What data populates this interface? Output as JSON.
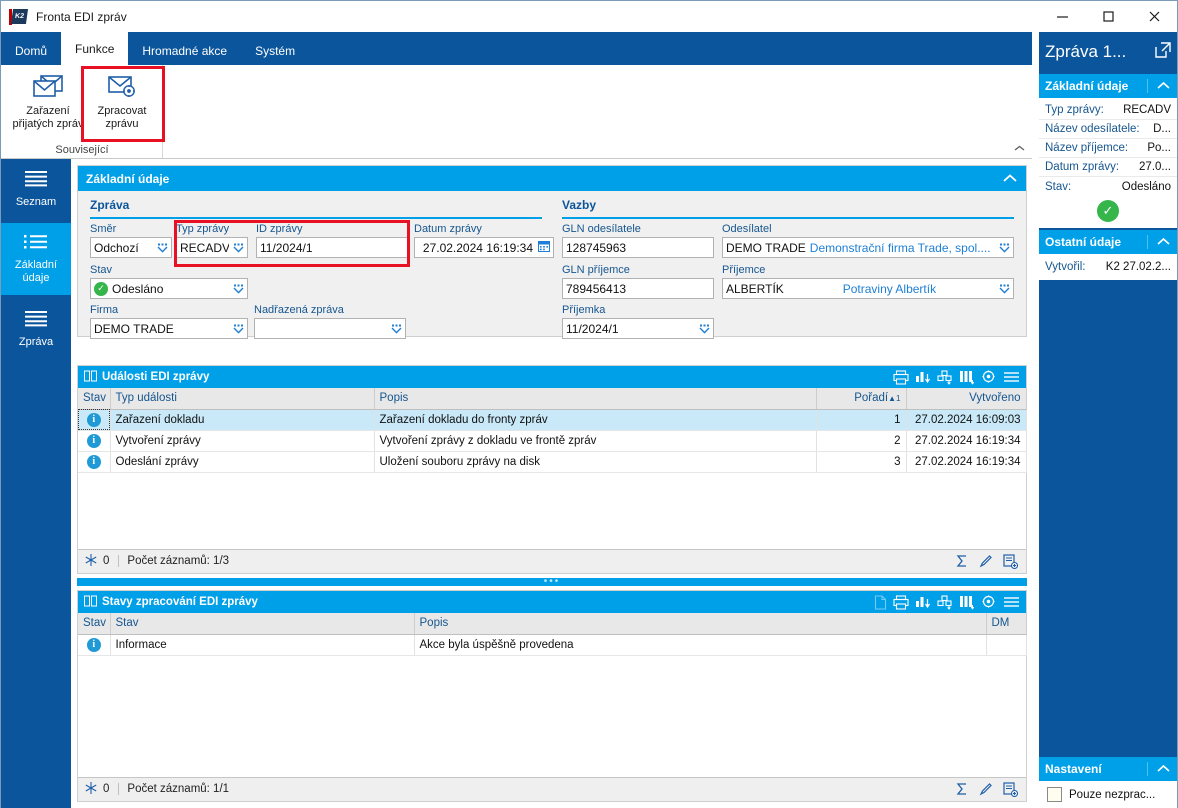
{
  "window": {
    "title": "Fronta EDI zpráv",
    "app_badge": "K2",
    "minimize": "—",
    "maximize": "□",
    "close": "✕"
  },
  "ribbon": {
    "tabs": [
      {
        "label": "Domů",
        "active": false
      },
      {
        "label": "Funkce",
        "active": true
      },
      {
        "label": "Hromadné akce",
        "active": false
      },
      {
        "label": "Systém",
        "active": false
      }
    ],
    "group_label": "Související",
    "buttons": [
      {
        "line1": "Zařazení",
        "line2": "přijatých zpráv",
        "icon": "envelope-icon",
        "highlighted": false
      },
      {
        "line1": "Zpracovat",
        "line2": "zprávu",
        "icon": "envelope-gear-icon",
        "highlighted": true
      }
    ]
  },
  "leftnav": {
    "items": [
      {
        "label": "Seznam",
        "icon": "list-icon",
        "active": false
      },
      {
        "label": "Základní údaje",
        "icon": "bullet-list-icon",
        "active": true
      },
      {
        "label": "Zpráva",
        "icon": "list-icon",
        "active": false
      }
    ]
  },
  "basic_panel": {
    "title": "Základní údaje",
    "message_section": {
      "title": "Zpráva",
      "smer": {
        "label": "Směr",
        "value": "Odchozí"
      },
      "typ_zpravy": {
        "label": "Typ zprávy",
        "value": "RECADV"
      },
      "id_zpravy": {
        "label": "ID zprávy",
        "value": "11/2024/1"
      },
      "datum_zpravy": {
        "label": "Datum zprávy",
        "value": "27.02.2024 16:19:34"
      },
      "stav": {
        "label": "Stav",
        "value": "Odesláno"
      },
      "firma": {
        "label": "Firma",
        "value": "DEMO TRADE"
      },
      "nadrazena_zprava": {
        "label": "Nadřazená zpráva",
        "value": ""
      }
    },
    "links_section": {
      "title": "Vazby",
      "gln_odesilatele": {
        "label": "GLN odesílatele",
        "value": "128745963"
      },
      "odesilatel": {
        "label": "Odesílatel",
        "value": "DEMO TRADE",
        "sub": "Demonstrační firma Trade, spol...."
      },
      "gln_prijemce": {
        "label": "GLN příjemce",
        "value": "789456413"
      },
      "prijemce": {
        "label": "Příjemce",
        "value": "ALBERTÍK",
        "sub": "Potraviny Albertík"
      },
      "prijemka": {
        "label": "Příjemka",
        "value": "11/2024/1"
      }
    }
  },
  "events_grid": {
    "title": "Události EDI zprávy",
    "columns": [
      "Stav",
      "Typ události",
      "Popis",
      "Pořadí",
      "Vytvořeno"
    ],
    "sort_column": "Pořadí",
    "sort_indicator": "▲",
    "sort_order": "1",
    "rows": [
      {
        "stav": "info",
        "typ": "Zařazení dokladu",
        "popis": "Zařazení dokladu do fronty zpráv",
        "poradi": "1",
        "vytvoreno": "27.02.2024 16:09:03",
        "selected": true
      },
      {
        "stav": "info",
        "typ": "Vytvoření zprávy",
        "popis": "Vytvoření zprávy z dokladu ve frontě zpráv",
        "poradi": "2",
        "vytvoreno": "27.02.2024 16:19:34",
        "selected": false
      },
      {
        "stav": "info",
        "typ": "Odeslání zprávy",
        "popis": "Uložení souboru zprávy na disk",
        "poradi": "3",
        "vytvoreno": "27.02.2024 16:19:34",
        "selected": false
      }
    ],
    "footer": {
      "badge": "0",
      "count_label": "Počet záznamů: 1/3"
    }
  },
  "states_grid": {
    "title": "Stavy zpracování EDI zprávy",
    "columns": [
      "Stav",
      "Stav",
      "Popis",
      "DM"
    ],
    "rows": [
      {
        "stav": "info",
        "stav_text": "Informace",
        "popis": "Akce byla úspěšně provedena",
        "dm": ""
      }
    ],
    "footer": {
      "badge": "0",
      "count_label": "Počet záznamů: 1/1"
    }
  },
  "rightbar": {
    "title": "Zpráva 1...",
    "sections": [
      {
        "title": "Základní údaje",
        "rows": [
          {
            "key": "Typ zprávy:",
            "value": "RECADV"
          },
          {
            "key": "Název odesílatele:",
            "value": "D..."
          },
          {
            "key": "Název příjemce:",
            "value": "Po..."
          },
          {
            "key": "Datum zprávy:",
            "value": "27.0..."
          },
          {
            "key": "Stav:",
            "value": "Odesláno"
          }
        ],
        "has_check": true
      },
      {
        "title": "Ostatní údaje",
        "rows": [
          {
            "key": "Vytvořil:",
            "value": "K2 27.02.2..."
          }
        ],
        "has_check": false
      }
    ],
    "settings": {
      "title": "Nastavení",
      "checkbox_label": "Pouze nezprac...",
      "checkbox_checked": false
    }
  },
  "colors": {
    "brand_blue": "#0b559c",
    "accent_cyan": "#00a0e9",
    "highlight_red": "#e81123",
    "status_green": "#36b54a",
    "selection_blue": "#c9e9f8"
  }
}
